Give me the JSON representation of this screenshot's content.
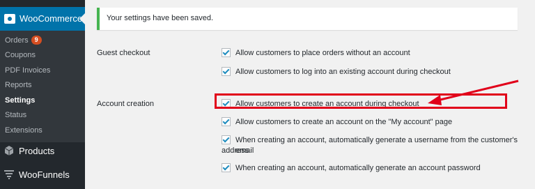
{
  "sidebar": {
    "woocommerce_label": "WooCommerce",
    "submenu": [
      {
        "label": "Orders",
        "badge": "9"
      },
      {
        "label": "Coupons"
      },
      {
        "label": "PDF Invoices"
      },
      {
        "label": "Reports"
      },
      {
        "label": "Settings"
      },
      {
        "label": "Status"
      },
      {
        "label": "Extensions"
      }
    ],
    "products_label": "Products",
    "woofunnels_label": "WooFunnels"
  },
  "notice": {
    "text": "Your settings have been saved."
  },
  "sections": {
    "guest_checkout": {
      "label": "Guest checkout",
      "options": [
        {
          "text": "Allow customers to place orders without an account",
          "checked": true
        },
        {
          "text": "Allow customers to log into an existing account during checkout",
          "checked": true
        }
      ]
    },
    "account_creation": {
      "label": "Account creation",
      "options": [
        {
          "text": "Allow customers to create an account during checkout",
          "checked": true
        },
        {
          "text": "Allow customers to create an account on the \"My account\" page",
          "checked": true
        },
        {
          "text": "When creating an account, automatically generate a username from the customer's email",
          "checked": true
        },
        {
          "text": "address"
        },
        {
          "text": "When creating an account, automatically generate an account password",
          "checked": true
        }
      ]
    }
  },
  "colors": {
    "accent": "#0073aa",
    "highlight": "#e1001a",
    "success": "#46b450",
    "badge": "#d54e21"
  }
}
